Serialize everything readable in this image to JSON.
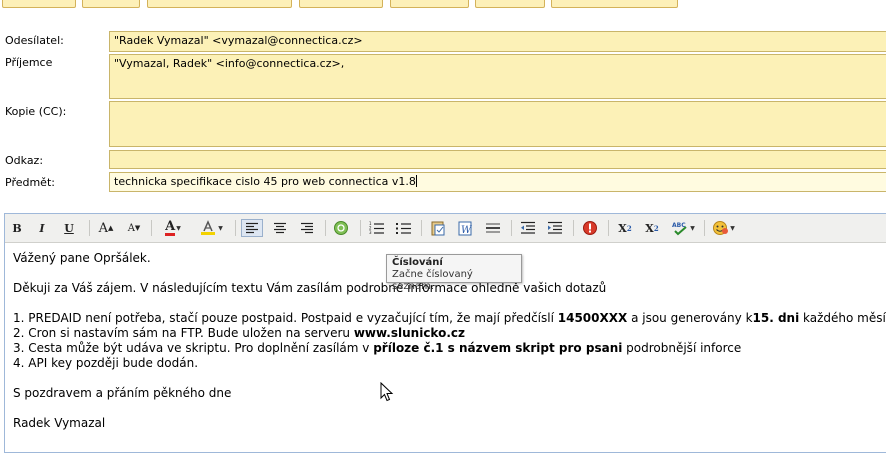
{
  "header": {
    "from_label": "Odesílatel:",
    "from_value": "\"Radek Vymazal\" <vymazal@connectica.cz>",
    "to_label": "Příjemce",
    "to_value": "\"Vymazal, Radek\" <info@connectica.cz>,",
    "cc_label": "Kopie (CC):",
    "cc_value": "",
    "reply_label": "Odkaz:",
    "reply_value": "",
    "subject_label": "Předmět:",
    "subject_value": "technicka specifikace cislo 45 pro web connectica v1.8"
  },
  "toolbar": {
    "bold": "B",
    "italic": "I",
    "underline": "U",
    "font_size_up": "A",
    "font_size_down": "A",
    "text_color": "A",
    "icons": [
      "bold-icon",
      "italic-icon",
      "underline-icon",
      "increase-font-icon",
      "decrease-font-icon",
      "text-color-icon",
      "highlight-icon",
      "align-left-icon",
      "align-center-icon",
      "align-right-icon",
      "insert-link-icon",
      "numbered-list-icon",
      "bulleted-list-icon",
      "paste-text-icon",
      "paste-word-icon",
      "horizontal-rule-icon",
      "outdent-icon",
      "indent-icon",
      "remove-format-icon",
      "subscript-icon",
      "superscript-icon",
      "spellcheck-icon",
      "emoticon-icon"
    ]
  },
  "tooltip": {
    "title": "Číslování",
    "description": "Začne číslovaný seznam."
  },
  "message": {
    "greeting": "Vážený pane Opršálek.",
    "intro": "Děkuji za Váš zájem. V následujícím textu Vám zasílám podrobné informace ohledně vašich dotazů",
    "item1_a": "1. PREDAID není potřeba, stačí pouze postpaid. Postpaid e vyzačující tím, že mají předčíslí ",
    "item1_b": "14500XXX",
    "item1_c": " a jsou generovány k",
    "item1_d": "15. dni",
    "item1_e": " každého měsíce.",
    "item2_a": "2. Cron si nastavím sám na FTP. Bude uložen na serveru ",
    "item2_b": "www.slunicko.cz",
    "item3_a": "3. Cesta může být udáva ve skriptu. Pro doplnění zasílám v ",
    "item3_b": "příloze č.1 s názvem skript pro psani",
    "item3_c": " podrobnější inforce",
    "item4": "4. API key později bude dodán.",
    "closing": "S pozdravem a přáním pěkného dne",
    "signature": "Radek Vymazal"
  },
  "colors": {
    "field_bg": "#fcf1b7",
    "field_border": "#c9b56a",
    "toolbar_bg": "#f0f0ee"
  }
}
